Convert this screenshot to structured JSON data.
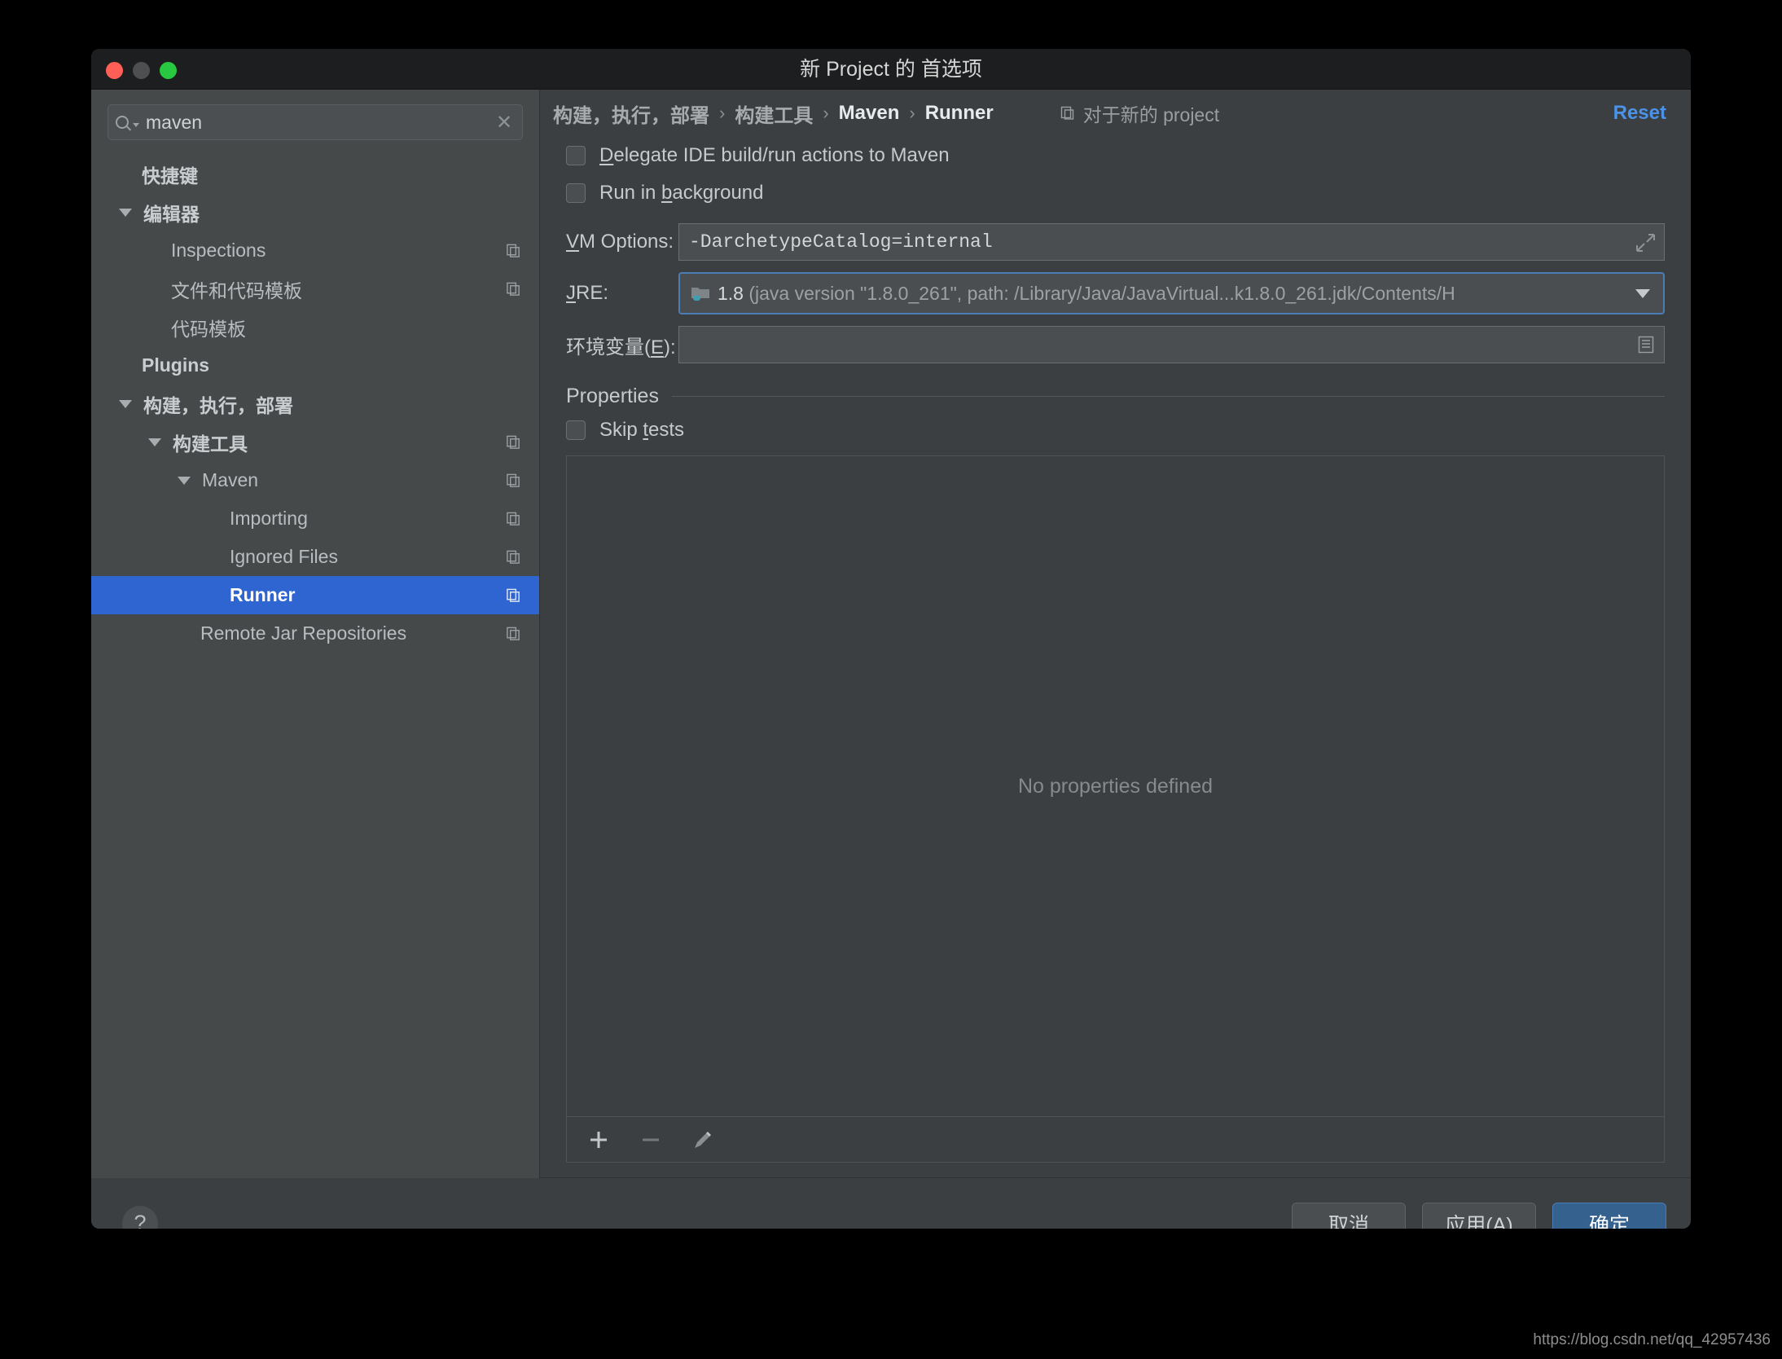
{
  "window": {
    "title": "新 Project 的 首选项",
    "traffic_lights": [
      "close-red",
      "minimize-yellow",
      "zoom-green"
    ]
  },
  "sidebar": {
    "search": {
      "value": "maven",
      "placeholder": "",
      "icon": "search-icon",
      "clear_icon": "clear-icon"
    },
    "items": [
      {
        "label": "快捷键",
        "indent": 0,
        "arrow": false,
        "bold": true,
        "copy": false,
        "selected": false
      },
      {
        "label": "编辑器",
        "indent": 0,
        "arrow": true,
        "bold": true,
        "copy": false,
        "selected": false
      },
      {
        "label": "Inspections",
        "indent": 1,
        "arrow": false,
        "bold": false,
        "copy": true,
        "selected": false
      },
      {
        "label": "文件和代码模板",
        "indent": 1,
        "arrow": false,
        "bold": false,
        "copy": true,
        "selected": false
      },
      {
        "label": "代码模板",
        "indent": 1,
        "arrow": false,
        "bold": false,
        "copy": false,
        "selected": false
      },
      {
        "label": "Plugins",
        "indent": 0,
        "arrow": false,
        "bold": true,
        "copy": false,
        "selected": false
      },
      {
        "label": "构建，执行，部署",
        "indent": 0,
        "arrow": true,
        "bold": true,
        "copy": false,
        "selected": false
      },
      {
        "label": "构建工具",
        "indent": 1,
        "arrow": true,
        "bold": true,
        "copy": true,
        "selected": false
      },
      {
        "label": "Maven",
        "indent": 2,
        "arrow": true,
        "bold": false,
        "copy": true,
        "selected": false
      },
      {
        "label": "Importing",
        "indent": 3,
        "arrow": false,
        "bold": false,
        "copy": true,
        "selected": false
      },
      {
        "label": "Ignored Files",
        "indent": 3,
        "arrow": false,
        "bold": false,
        "copy": true,
        "selected": false
      },
      {
        "label": "Runner",
        "indent": 3,
        "arrow": false,
        "bold": false,
        "copy": true,
        "selected": true
      },
      {
        "label": "Remote Jar Repositories",
        "indent": 2,
        "arrow": false,
        "bold": false,
        "copy": true,
        "selected": false
      }
    ]
  },
  "breadcrumb": {
    "items": [
      "构建，执行，部署",
      "构建工具",
      "Maven",
      "Runner"
    ],
    "separator": "›",
    "scope_label": "对于新的 project",
    "scope_icon": "copy-icon",
    "reset_label": "Reset",
    "reset_color": "#4a93e8"
  },
  "form": {
    "checkbox_delegate": {
      "label_pre": "",
      "label_mnemonic": "D",
      "label_post": "elegate IDE build/run actions to Maven",
      "checked": false
    },
    "checkbox_background": {
      "label_pre": "Run in ",
      "label_mnemonic": "b",
      "label_post": "ackground",
      "checked": false
    },
    "vm_options": {
      "label_mnemonic": "V",
      "label_post": "M Options:",
      "value": "-DarchetypeCatalog=internal",
      "expand_icon": "expand-icon"
    },
    "jre": {
      "label_mnemonic": "J",
      "label_post": "RE:",
      "icon": "java-folder-icon",
      "value_strong": "1.8",
      "value_dim": "(java version \"1.8.0_261\", path: /Library/Java/JavaVirtual...k1.8.0_261.jdk/Contents/H",
      "arrow_icon": "chevron-down-icon"
    },
    "env_vars": {
      "label_pre": "环境变量(",
      "label_mnemonic": "E",
      "label_post": "):",
      "value": "",
      "browse_icon": "list-icon"
    },
    "properties_section": {
      "title": "Properties",
      "skip_tests": {
        "label_pre": "Skip ",
        "label_mnemonic": "t",
        "label_post": "ests",
        "checked": false
      },
      "empty_text": "No properties defined",
      "toolbar": [
        {
          "name": "add-property-button",
          "icon": "plus-icon",
          "enabled": true
        },
        {
          "name": "remove-property-button",
          "icon": "minus-icon",
          "enabled": false
        },
        {
          "name": "edit-property-button",
          "icon": "pencil-icon",
          "enabled": true
        }
      ]
    }
  },
  "footer": {
    "help_label": "?",
    "cancel_label": "取消",
    "apply_label": "应用(A)",
    "apply_mnemonic": "A",
    "ok_label": "确定"
  },
  "watermark": "https://blog.csdn.net/qq_42957436"
}
